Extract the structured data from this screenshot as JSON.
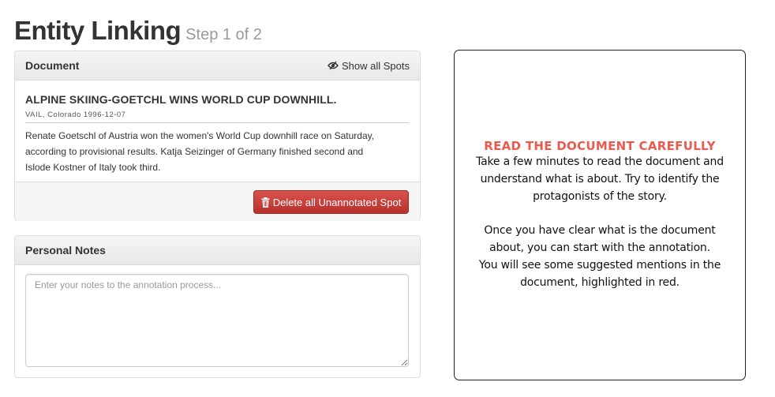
{
  "header": {
    "title": "Entity Linking",
    "step": "Step 1 of 2"
  },
  "document_panel": {
    "title": "Document",
    "show_spots_label": "Show all Spots",
    "show_spots_icon": "eye-icon",
    "headline": "ALPINE SKIING-GOETCHL WINS WORLD CUP DOWNHILL.",
    "dateline": "VAIL, Colorado 1996-12-07",
    "body_lines": [
      "Renate Goetschl of Austria won the women's World Cup downhill race on Saturday,",
      "according to provisional results. Katja Seizinger of Germany finished second and",
      "Islode Kostner of Italy took third."
    ],
    "delete_button_label": "Delete all Unannotated Spot",
    "delete_button_icon": "trash-icon",
    "delete_button_color": "#d9534f"
  },
  "notes_panel": {
    "title": "Personal Notes",
    "placeholder": "Enter your notes to the annotation process..."
  },
  "instructions": {
    "title": "READ THE DOCUMENT CAREFULLY",
    "title_color": "#ec5a4f",
    "paragraph1_lines": [
      "Take a few minutes to read the document and",
      "understand what is about. Try to identify the",
      "protagonists of the story."
    ],
    "paragraph2_lines": [
      "Once you have clear what is the document",
      "about, you can start with the annotation.",
      "You will see some suggested mentions in the",
      "document, highlighted in red."
    ]
  }
}
